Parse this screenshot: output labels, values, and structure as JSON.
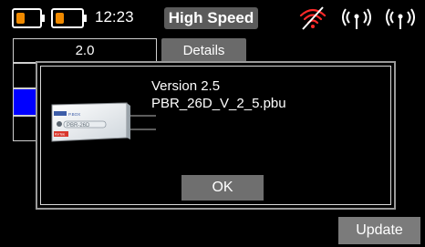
{
  "status_bar": {
    "time": "12:23",
    "mode": "High Speed",
    "battery_color": "#f08a00",
    "icons": [
      "battery-icon",
      "battery-icon",
      "wifi-off-icon",
      "radio-signal-icon",
      "radio-signal-icon"
    ]
  },
  "main": {
    "value_field": "2.0",
    "details_tab": "Details",
    "selected_row_color": "#0000ff",
    "update_button": "Update"
  },
  "dialog": {
    "version": "Version 2.5",
    "filename": "PBR_26D_V_2_5.pbu",
    "ok_button": "OK",
    "device_image": {
      "brand": "P.BOX",
      "model_label": "PBR-26D",
      "tag": "Rx/Tele"
    }
  }
}
